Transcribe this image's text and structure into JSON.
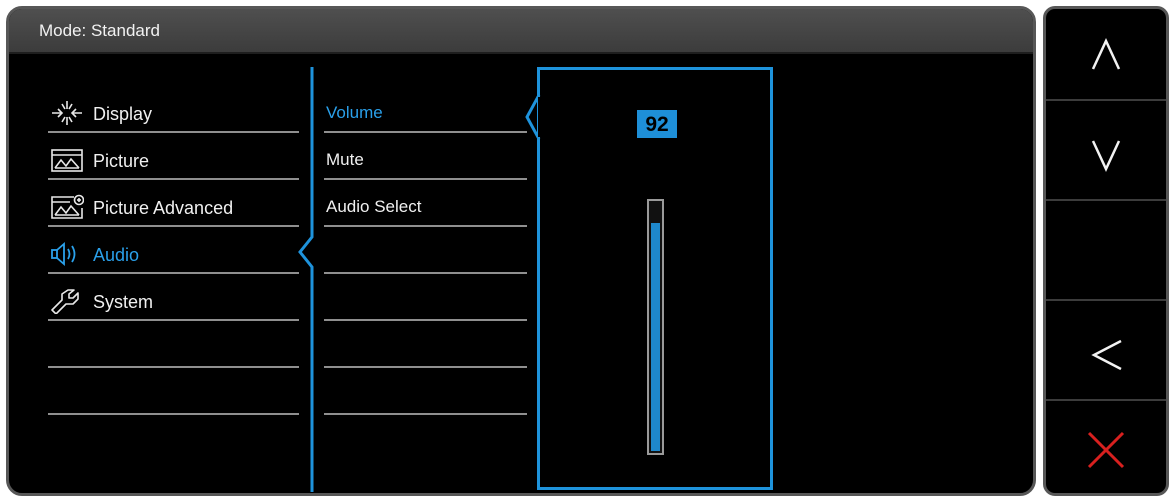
{
  "osd": {
    "title": "Mode: Standard"
  },
  "menu": {
    "items": [
      {
        "label": "Display",
        "icon": "display-icon"
      },
      {
        "label": "Picture",
        "icon": "picture-icon"
      },
      {
        "label": "Picture Advanced",
        "icon": "picture-advanced-icon"
      },
      {
        "label": "Audio",
        "icon": "audio-icon",
        "active": true
      },
      {
        "label": "System",
        "icon": "wrench-icon"
      }
    ]
  },
  "submenu": {
    "items": [
      {
        "label": "Volume",
        "active": true
      },
      {
        "label": "Mute"
      },
      {
        "label": "Audio Select"
      }
    ]
  },
  "volume": {
    "value": "92",
    "level": 0.92
  },
  "keys": [
    {
      "name": "up",
      "icon": "chevron-up-icon"
    },
    {
      "name": "down",
      "icon": "chevron-down-icon"
    },
    {
      "name": "blank"
    },
    {
      "name": "back",
      "icon": "chevron-left-icon"
    },
    {
      "name": "exit",
      "icon": "close-icon"
    }
  ],
  "colors": {
    "accent": "#1e93dc",
    "close": "#d8201f",
    "text": "#f0f0f0"
  }
}
